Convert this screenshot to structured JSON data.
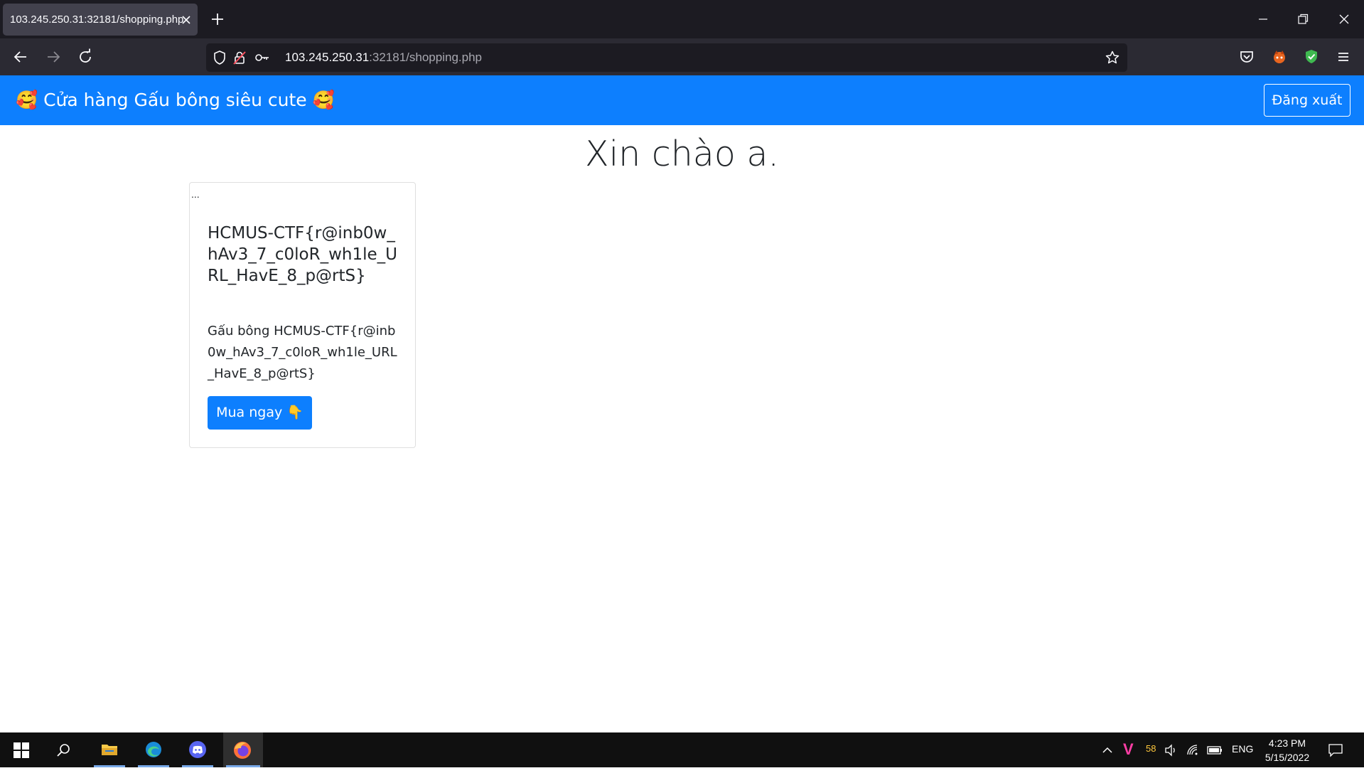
{
  "browser": {
    "tab_title": "103.245.250.31:32181/shopping.php",
    "url_host": "103.245.250.31",
    "url_rest": ":32181/shopping.php"
  },
  "site": {
    "brand": "🥰 Cửa hàng Gấu bông siêu cute 🥰",
    "logout_label": "Đăng xuất",
    "greeting": "Xin chào a."
  },
  "card": {
    "img_alt": "...",
    "title": "HCMUS-CTF{r@inb0w_hAv3_7_c0loR_wh1le_URL_HavE_8_p@rtS}",
    "text": "Gấu bông HCMUS-CTF{r@inb0w_hAv3_7_c0loR_wh1le_URL_HavE_8_p@rtS}",
    "button_label": "Mua ngay 👇"
  },
  "taskbar": {
    "tray_badge": "58",
    "language": "ENG",
    "time": "4:23 PM",
    "date": "5/15/2022"
  },
  "colors": {
    "accent": "#0d7ffe",
    "browser_bg": "#1c1b22",
    "toolbar_bg": "#2b2a33"
  }
}
